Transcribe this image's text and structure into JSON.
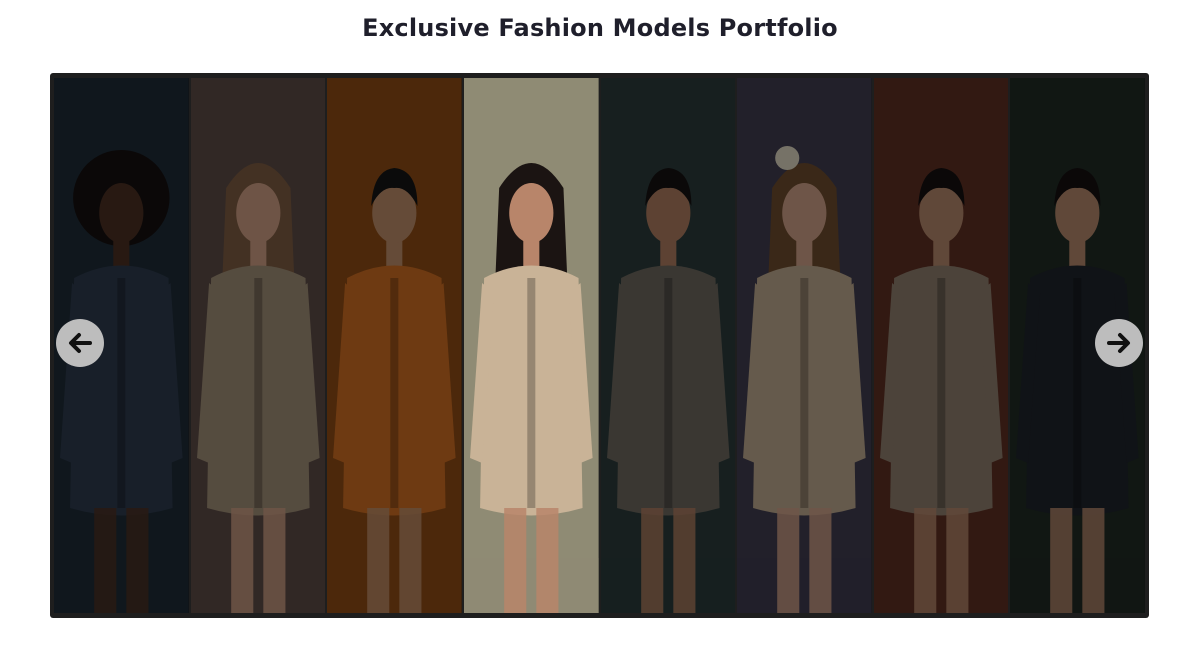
{
  "page": {
    "title": "Exclusive Fashion Models Portfolio"
  },
  "carousel": {
    "active_index": 3,
    "prev_icon": "arrow-left-icon",
    "next_icon": "arrow-right-icon",
    "slides": [
      {
        "name": "model-1",
        "bg": "#1e2b36",
        "skin": "#4a2f22",
        "hair": "#141010",
        "outfit": "#2c3a4c",
        "hair_style": "afro"
      },
      {
        "name": "model-2",
        "bg": "#5a4a44",
        "skin": "#c99a80",
        "hair": "#7b5a40",
        "outfit": "#9c8a74",
        "hair_style": "long"
      },
      {
        "name": "model-3",
        "bg": "#8a4a14",
        "skin": "#b88966",
        "hair": "#141414",
        "outfit": "#c86a22",
        "hair_style": "short"
      },
      {
        "name": "model-4",
        "bg": "#8f8b74",
        "skin": "#b8856a",
        "hair": "#1b1412",
        "outfit": "#c9b397",
        "hair_style": "long"
      },
      {
        "name": "model-5",
        "bg": "#2a3a3a",
        "skin": "#a9795d",
        "hair": "#151212",
        "outfit": "#6a655c",
        "hair_style": "short"
      },
      {
        "name": "model-6",
        "bg": "#3e3b4e",
        "skin": "#c99c84",
        "hair": "#6a4a2c",
        "outfit": "#b9a48a",
        "hair_style": "wavy"
      },
      {
        "name": "model-7",
        "bg": "#5c2e22",
        "skin": "#b08468",
        "hair": "#141010",
        "outfit": "#8a7a6a",
        "hair_style": "short"
      },
      {
        "name": "model-8",
        "bg": "#1f2a24",
        "skin": "#b08468",
        "hair": "#141010",
        "outfit": "#1e232a",
        "hair_style": "short"
      }
    ]
  }
}
